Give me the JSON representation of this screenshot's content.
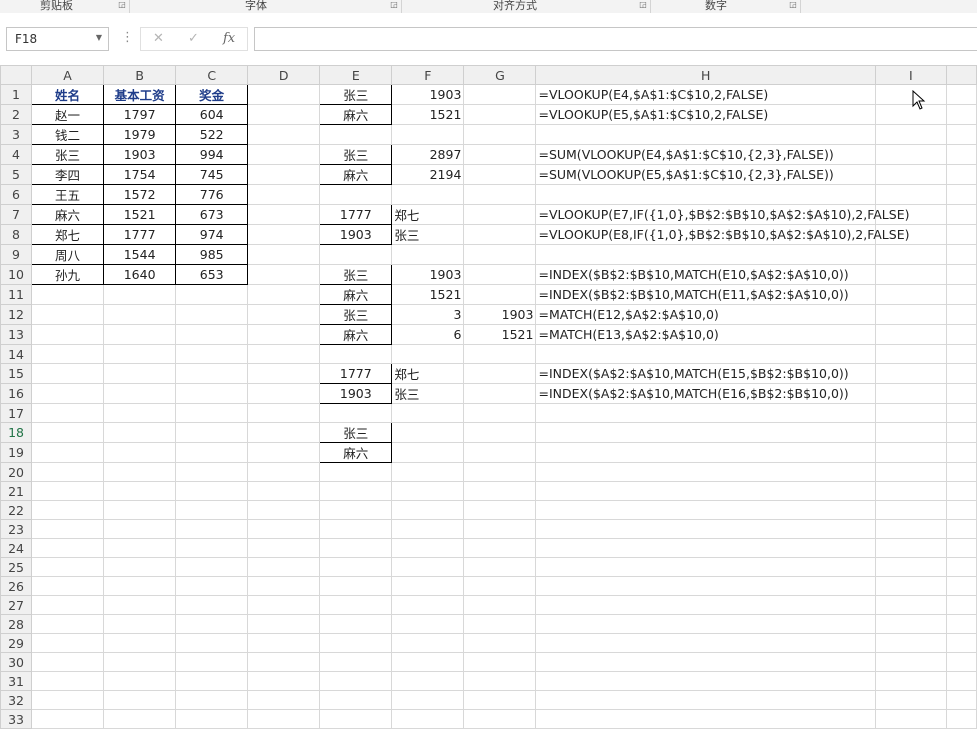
{
  "ribbon": {
    "groups": [
      "剪贴板",
      "字体",
      "对齐方式",
      "数字"
    ]
  },
  "formula_bar": {
    "name_box": "F18",
    "cancel_icon": "✕",
    "enter_icon": "✓",
    "fx_label": "fx",
    "formula": ""
  },
  "columns": [
    "A",
    "B",
    "C",
    "D",
    "E",
    "F",
    "G",
    "H",
    "I"
  ],
  "rows": [
    {
      "A": "姓名",
      "B": "基本工资",
      "C": "奖金",
      "E": "张三",
      "F": "1903",
      "G": "",
      "H": "=VLOOKUP(E4,$A$1:$C$10,2,FALSE)"
    },
    {
      "A": "赵一",
      "B": "1797",
      "C": "604",
      "E": "麻六",
      "F": "1521",
      "G": "",
      "H": "=VLOOKUP(E5,$A$1:$C$10,2,FALSE)"
    },
    {
      "A": "钱二",
      "B": "1979",
      "C": "522",
      "E": "",
      "F": "",
      "G": "",
      "H": ""
    },
    {
      "A": "张三",
      "B": "1903",
      "C": "994",
      "E": "张三",
      "F": "2897",
      "G": "",
      "H": "=SUM(VLOOKUP(E4,$A$1:$C$10,{2,3},FALSE))"
    },
    {
      "A": "李四",
      "B": "1754",
      "C": "745",
      "E": "麻六",
      "F": "2194",
      "G": "",
      "H": "=SUM(VLOOKUP(E5,$A$1:$C$10,{2,3},FALSE))"
    },
    {
      "A": "王五",
      "B": "1572",
      "C": "776",
      "E": "",
      "F": "",
      "G": "",
      "H": ""
    },
    {
      "A": "麻六",
      "B": "1521",
      "C": "673",
      "E": "1777",
      "F": "郑七",
      "G": "",
      "H": "=VLOOKUP(E7,IF({1,0},$B$2:$B$10,$A$2:$A$10),2,FALSE)"
    },
    {
      "A": "郑七",
      "B": "1777",
      "C": "974",
      "E": "1903",
      "F": "张三",
      "G": "",
      "H": "=VLOOKUP(E8,IF({1,0},$B$2:$B$10,$A$2:$A$10),2,FALSE)"
    },
    {
      "A": "周八",
      "B": "1544",
      "C": "985",
      "E": "",
      "F": "",
      "G": "",
      "H": ""
    },
    {
      "A": "孙九",
      "B": "1640",
      "C": "653",
      "E": "张三",
      "F": "1903",
      "G": "",
      "H": "=INDEX($B$2:$B$10,MATCH(E10,$A$2:$A$10,0))"
    },
    {
      "A": "",
      "B": "",
      "C": "",
      "E": "麻六",
      "F": "1521",
      "G": "",
      "H": "=INDEX($B$2:$B$10,MATCH(E11,$A$2:$A$10,0))"
    },
    {
      "A": "",
      "B": "",
      "C": "",
      "E": "张三",
      "F": "3",
      "G": "1903",
      "H": "=MATCH(E12,$A$2:$A$10,0)"
    },
    {
      "A": "",
      "B": "",
      "C": "",
      "E": "麻六",
      "F": "6",
      "G": "1521",
      "H": "=MATCH(E13,$A$2:$A$10,0)"
    },
    {
      "A": "",
      "B": "",
      "C": "",
      "E": "",
      "F": "",
      "G": "",
      "H": ""
    },
    {
      "A": "",
      "B": "",
      "C": "",
      "E": "1777",
      "F": "郑七",
      "G": "",
      "H": "=INDEX($A$2:$A$10,MATCH(E15,$B$2:$B$10,0))"
    },
    {
      "A": "",
      "B": "",
      "C": "",
      "E": "1903",
      "F": "张三",
      "G": "",
      "H": "=INDEX($A$2:$A$10,MATCH(E16,$B$2:$B$10,0))"
    },
    {
      "A": "",
      "B": "",
      "C": "",
      "E": "",
      "F": "",
      "G": "",
      "H": ""
    },
    {
      "A": "",
      "B": "",
      "C": "",
      "E": "张三",
      "F": "",
      "G": "",
      "H": ""
    },
    {
      "A": "",
      "B": "",
      "C": "",
      "E": "麻六",
      "F": "",
      "G": "",
      "H": ""
    }
  ],
  "row_numbers": [
    "1",
    "2",
    "3",
    "4",
    "5",
    "6",
    "7",
    "8",
    "9",
    "10",
    "11",
    "12",
    "13",
    "14",
    "15",
    "16",
    "17",
    "18",
    "19",
    "20",
    "21",
    "22",
    "23",
    "24",
    "25",
    "26",
    "27",
    "28",
    "29",
    "30",
    "31",
    "32",
    "33"
  ],
  "colors": {
    "header_text": "#1f3d8a",
    "selected_accent": "#217346"
  }
}
